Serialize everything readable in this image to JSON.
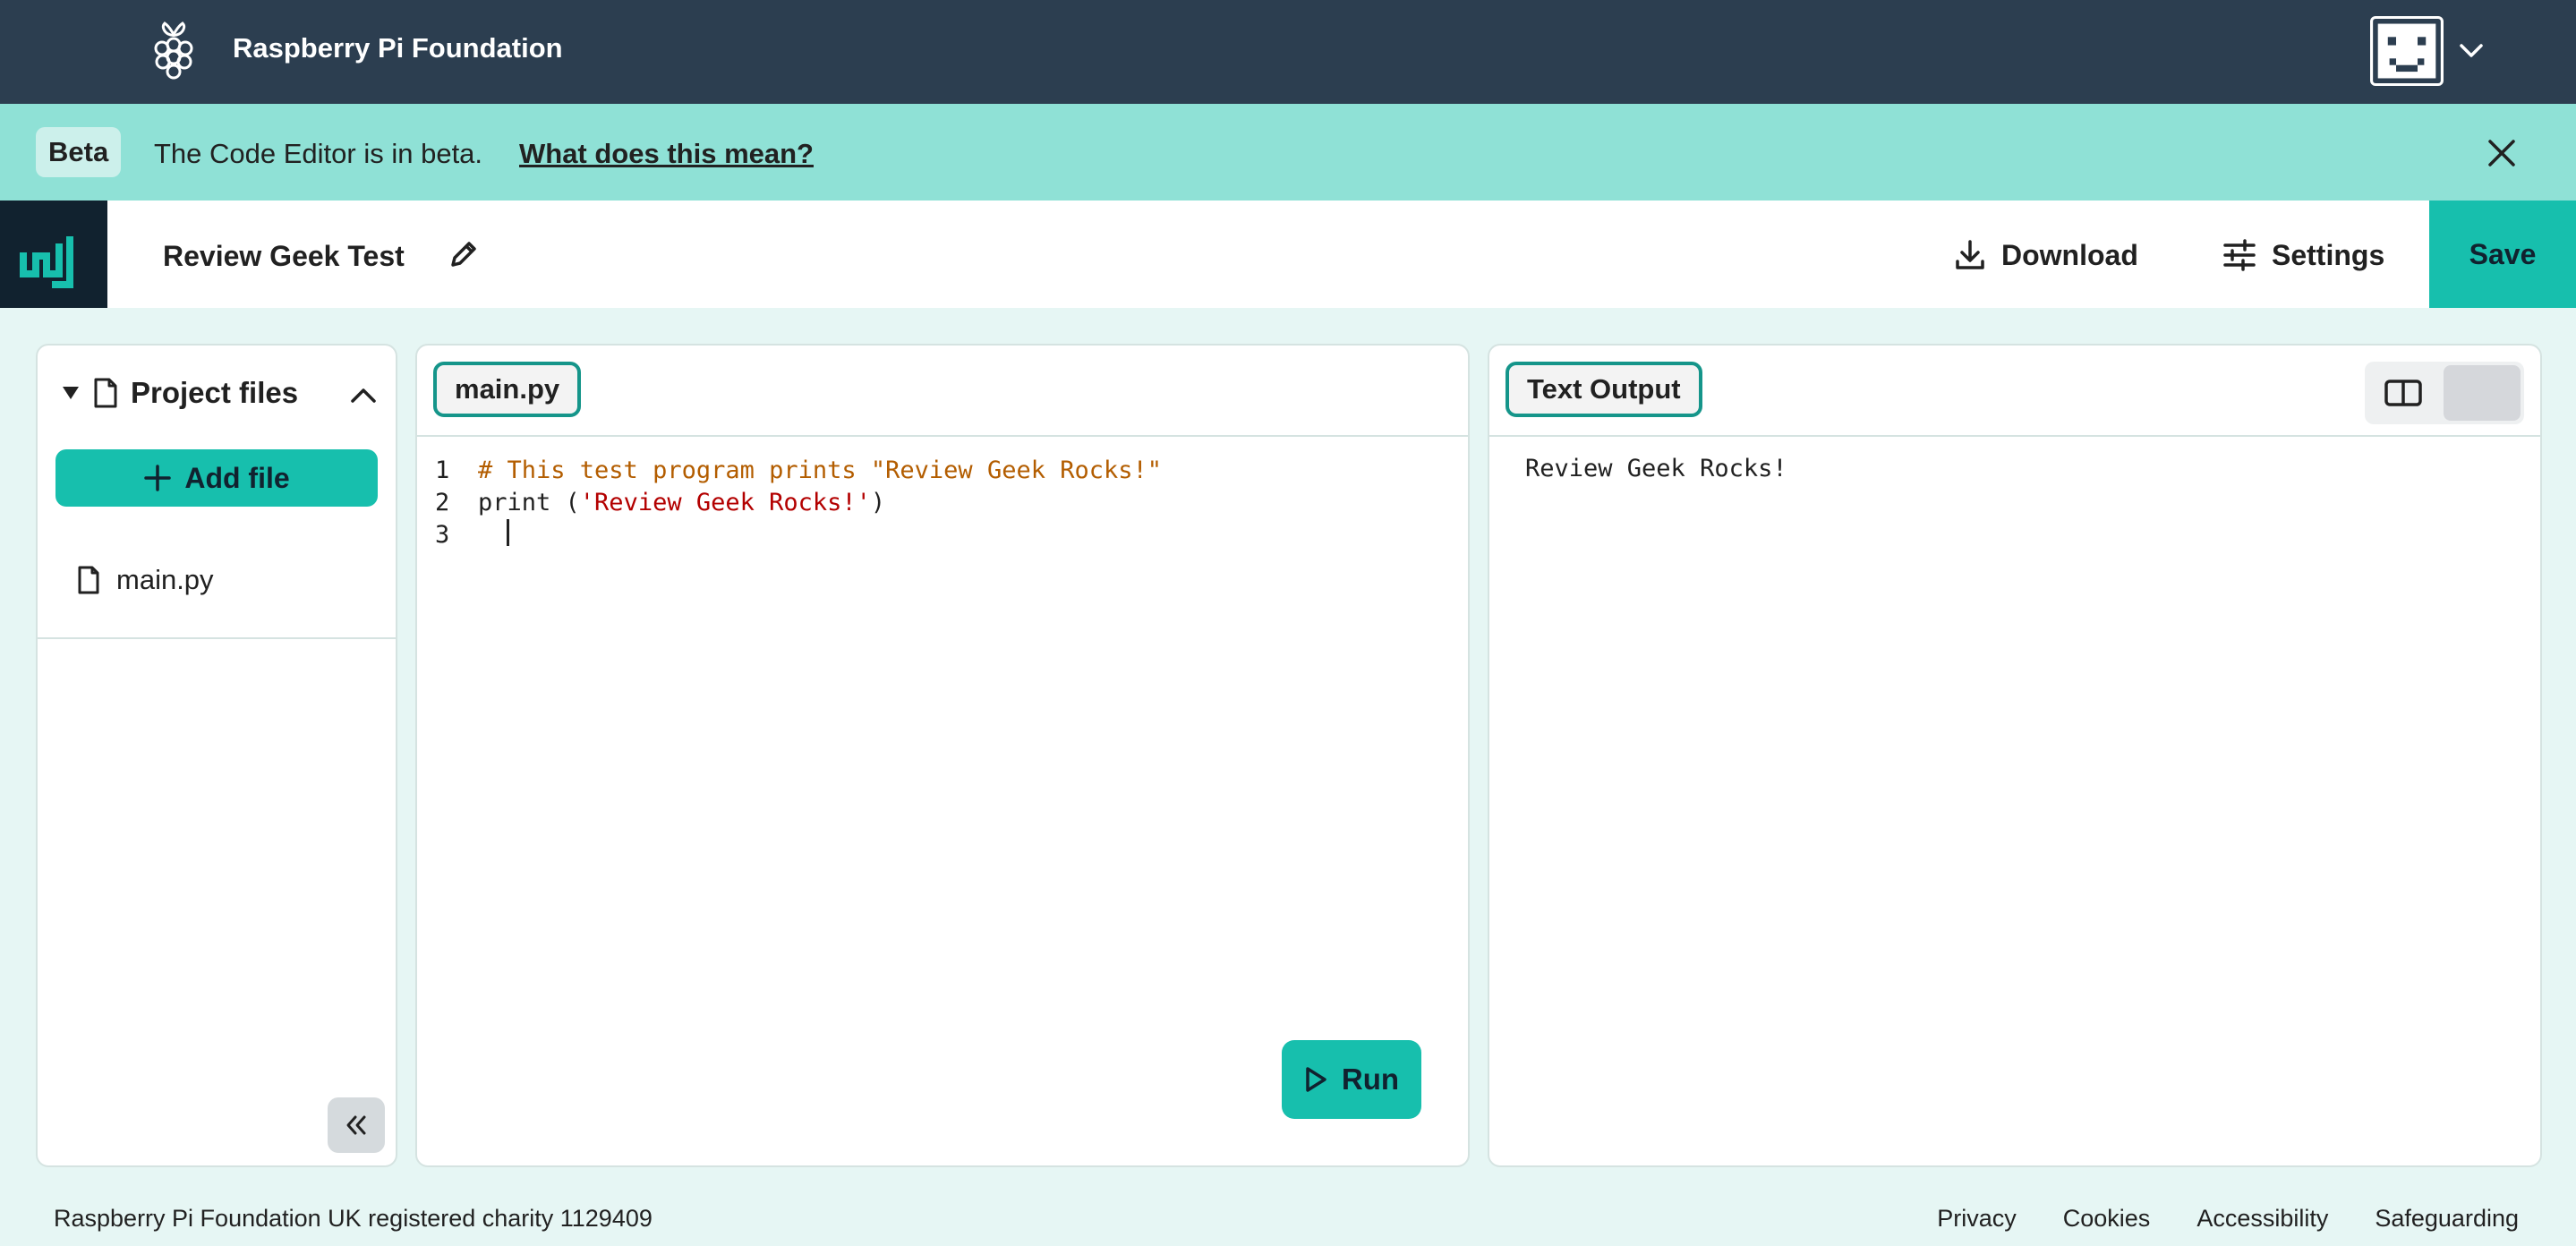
{
  "header": {
    "brand": "Raspberry Pi Foundation",
    "logo_icon": "raspberry-pi-logo",
    "avatar_icon": "robot-face-avatar",
    "menu_icon": "chevron-down-icon"
  },
  "banner": {
    "badge": "Beta",
    "message": "The Code Editor is in beta.",
    "link": "What does this mean?",
    "close_icon": "close-icon"
  },
  "project": {
    "name": "Review Geek Test",
    "edit_icon": "pencil-icon",
    "download_label": "Download",
    "settings_label": "Settings",
    "save_label": "Save"
  },
  "files": {
    "title": "Project files",
    "add_label": "Add file",
    "items": [
      {
        "name": "main.py"
      }
    ]
  },
  "editor": {
    "tab": "main.py",
    "lines": [
      {
        "n": "1",
        "comment": "# This test program prints \"Review Geek Rocks!\""
      },
      {
        "n": "2",
        "code": "print (",
        "string": "'Review Geek Rocks!'",
        "code_end": ")"
      },
      {
        "n": "3"
      }
    ],
    "run_label": "Run"
  },
  "output": {
    "tab": "Text Output",
    "text": "Review Geek Rocks!"
  },
  "footer": {
    "charity": "Raspberry Pi Foundation UK registered charity 1129409",
    "links": [
      "Privacy",
      "Cookies",
      "Accessibility",
      "Safeguarding"
    ]
  },
  "colors": {
    "topbar": "#2c3e50",
    "banner": "#8fe1d6",
    "accent": "#17bfad",
    "tab_border": "#15958a",
    "comment": "#b35d00",
    "string": "#b30000"
  }
}
